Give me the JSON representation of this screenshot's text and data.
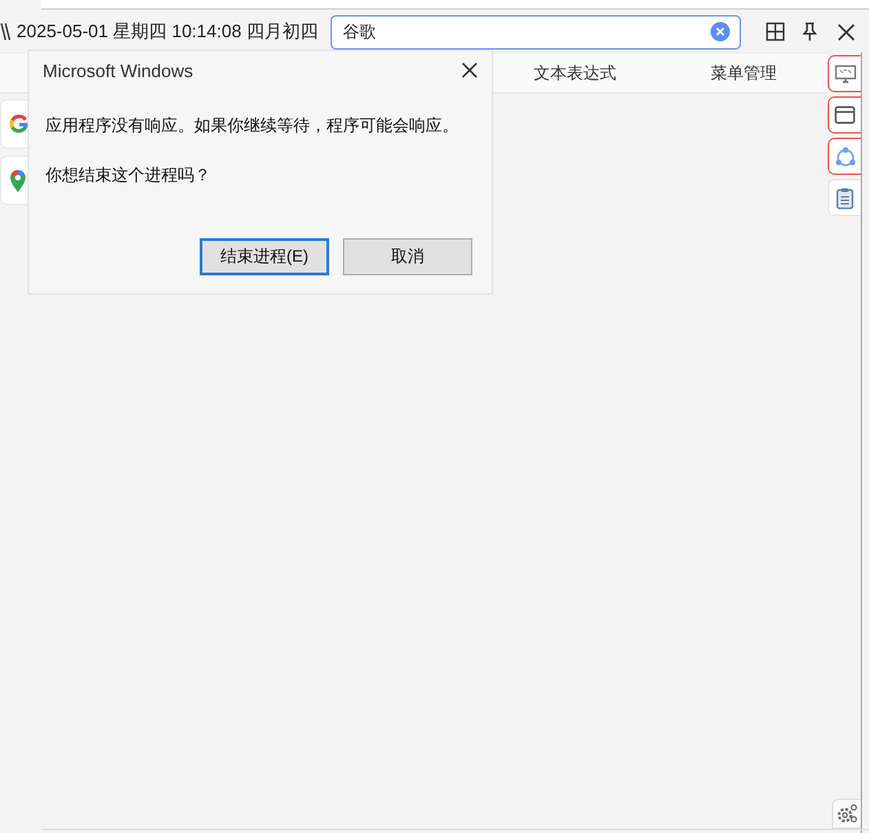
{
  "clock": {
    "text": "2025-05-01 星期四 10:14:08 四月初四"
  },
  "search": {
    "value": "谷歌"
  },
  "tabs": [
    {
      "label": "文本表达式",
      "selected": false
    },
    {
      "label": "菜单管理",
      "selected": false
    }
  ],
  "shortcuts": [
    {
      "kind": "google"
    },
    {
      "kind": "map"
    }
  ],
  "side_tools": [
    {
      "kind": "screen",
      "selected": true
    },
    {
      "kind": "window",
      "selected": true
    },
    {
      "kind": "share",
      "selected": true
    },
    {
      "kind": "clipboard",
      "selected": false
    }
  ],
  "dialog": {
    "title": "Microsoft Windows",
    "message": "应用程序没有响应。如果你继续等待，程序可能会响应。",
    "question": "你想结束这个进程吗？",
    "buttons": [
      {
        "label": "结束进程(E)",
        "selected": true
      },
      {
        "label": "取消",
        "selected": false
      }
    ]
  }
}
